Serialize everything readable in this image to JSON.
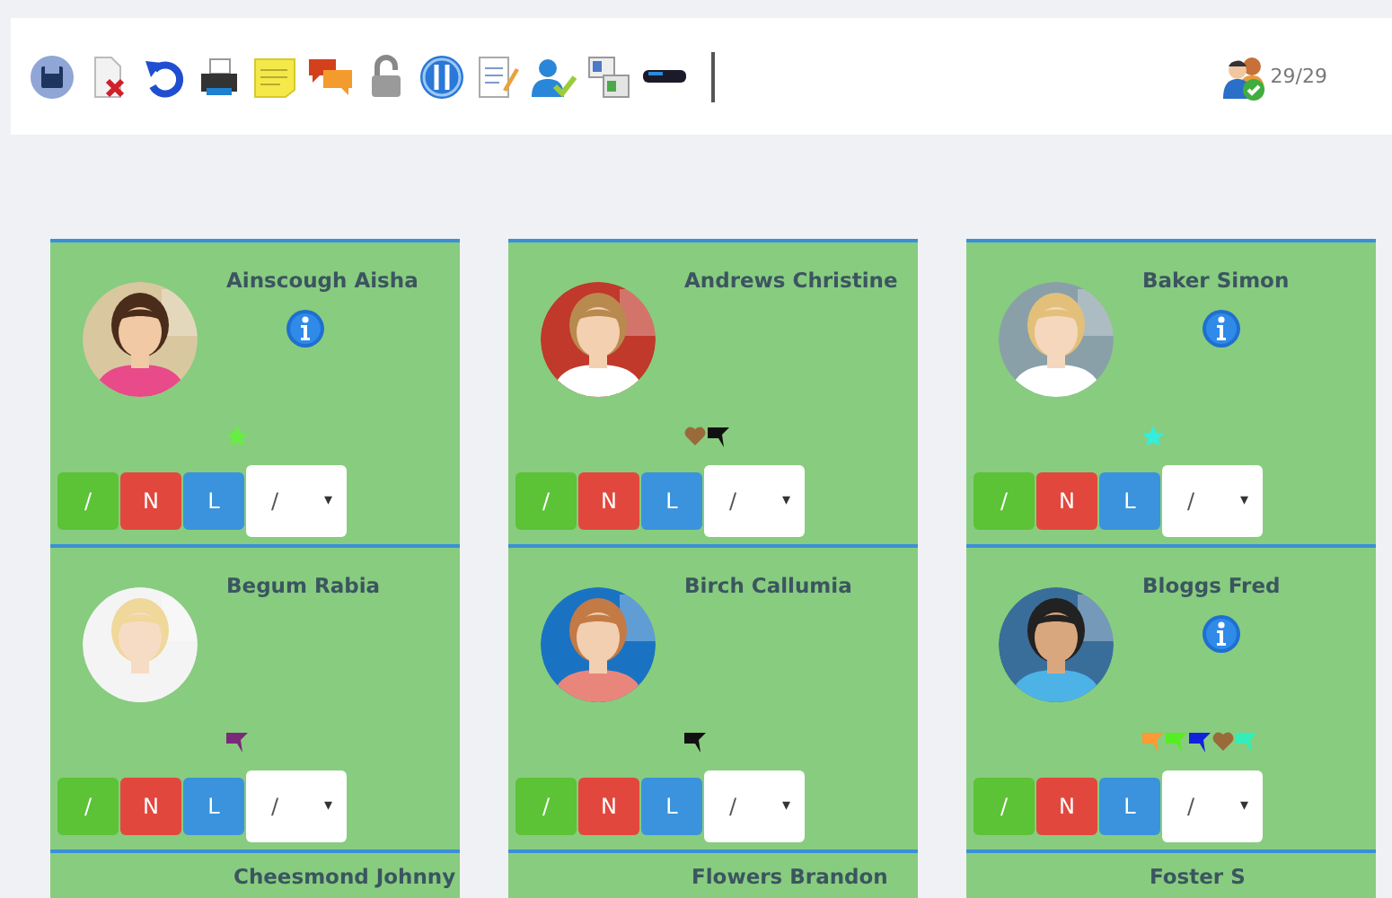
{
  "toolbar": {
    "count": "29/29"
  },
  "cards": [
    {
      "name": "Ainscough Aisha",
      "photo": {
        "kind": "picture"
      },
      "info": true,
      "markers": [
        {
          "kind": "star",
          "color": "#66ee44"
        }
      ],
      "buttons": [
        "/",
        "N",
        "L"
      ],
      "select": {
        "value": "/",
        "arrow": "▾"
      }
    },
    {
      "name": "Andrews Christine",
      "photo": {
        "kind": "picture"
      },
      "info": false,
      "markers": [
        {
          "kind": "heart",
          "color": "#9a6a3a"
        },
        {
          "kind": "flag",
          "color": "#111111"
        }
      ],
      "buttons": [
        "/",
        "N",
        "L"
      ],
      "select": {
        "value": "/",
        "arrow": "▾"
      }
    },
    {
      "name": "Baker Simon",
      "photo": {
        "kind": "picture"
      },
      "info": true,
      "markers": [
        {
          "kind": "star",
          "color": "#33eedd"
        }
      ],
      "buttons": [
        "/",
        "N",
        "L"
      ],
      "select": {
        "value": "/",
        "arrow": "▾"
      }
    },
    {
      "name": "Begum Rabia",
      "photo": {
        "kind": "picture"
      },
      "info": false,
      "markers": [
        {
          "kind": "flag",
          "color": "#7a2a7a"
        }
      ],
      "buttons": [
        "/",
        "N",
        "L"
      ],
      "select": {
        "value": "/",
        "arrow": "▾"
      }
    },
    {
      "name": "Birch Callumia",
      "photo": {
        "kind": "picture"
      },
      "info": false,
      "markers": [
        {
          "kind": "flag",
          "color": "#111111"
        }
      ],
      "buttons": [
        "/",
        "N",
        "L"
      ],
      "select": {
        "value": "/",
        "arrow": "▾"
      }
    },
    {
      "name": "Bloggs Fred",
      "photo": {
        "kind": "picture"
      },
      "info": true,
      "markers": [
        {
          "kind": "flag",
          "color": "#ff9933"
        },
        {
          "kind": "flag",
          "color": "#55ee22"
        },
        {
          "kind": "flag",
          "color": "#1122dd"
        },
        {
          "kind": "heart",
          "color": "#9a6a3a"
        },
        {
          "kind": "flag",
          "color": "#33eebb"
        }
      ],
      "buttons": [
        "/",
        "N",
        "L"
      ],
      "select": {
        "value": "/",
        "arrow": "▾"
      }
    },
    {
      "name": "Cheesmond Johnny"
    },
    {
      "name": "Flowers Brandon"
    },
    {
      "name": "Foster S"
    }
  ]
}
